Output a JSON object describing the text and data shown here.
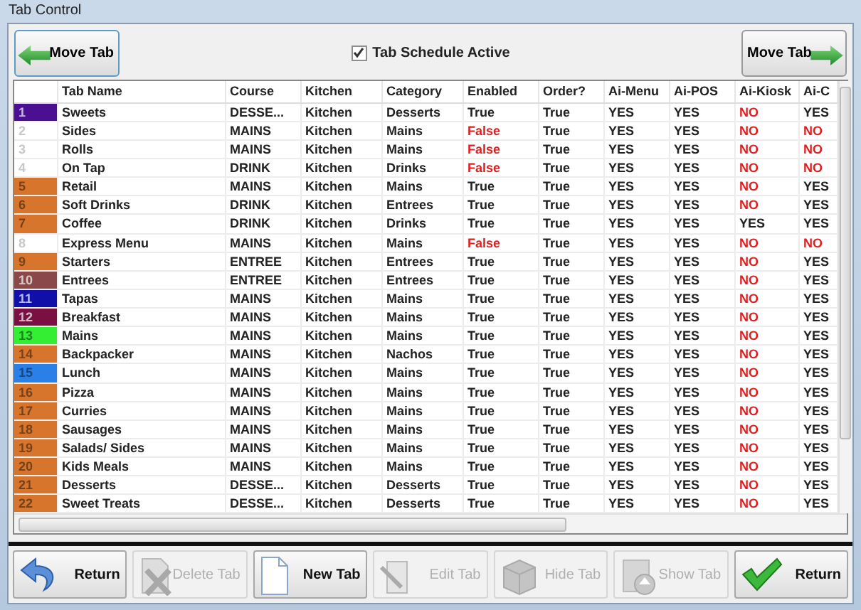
{
  "window": {
    "title": "Tab Control"
  },
  "toolbar": {
    "move_left": {
      "label": "Move Tab",
      "kind": "arrow-left"
    },
    "schedule": {
      "label": "Tab Schedule Active",
      "checked": true
    },
    "move_right": {
      "label": "Move Tab",
      "kind": "arrow-right"
    }
  },
  "table": {
    "columns": [
      "",
      "Tab Name",
      "Course",
      "Kitchen",
      "Category",
      "Enabled",
      "Order?",
      "Ai-Menu",
      "Ai-POS",
      "Ai-Kiosk",
      "Ai-C"
    ],
    "rows": [
      {
        "number": "1",
        "color": "#4b1091",
        "name": "Sweets",
        "course": "DESSE...",
        "kitchen": "Kitchen",
        "category": "Desserts",
        "enabled": {
          "text": "True",
          "on": true
        },
        "order": "True",
        "ai_menu": "YES",
        "ai_pos": "YES",
        "ai_kiosk": {
          "text": "NO",
          "on": false
        },
        "ai_c": {
          "text": "YES",
          "on": true
        }
      },
      {
        "number": "2",
        "name": "Sides",
        "course": "MAINS",
        "kitchen": "Kitchen",
        "category": "Mains",
        "enabled": {
          "text": "False",
          "on": false
        },
        "order": "True",
        "ai_menu": "YES",
        "ai_pos": "YES",
        "ai_kiosk": {
          "text": "NO",
          "on": false
        },
        "ai_c": {
          "text": "NO",
          "on": false
        }
      },
      {
        "number": "3",
        "name": "Rolls",
        "course": "MAINS",
        "kitchen": "Kitchen",
        "category": "Mains",
        "enabled": {
          "text": "False",
          "on": false
        },
        "order": "True",
        "ai_menu": "YES",
        "ai_pos": "YES",
        "ai_kiosk": {
          "text": "NO",
          "on": false
        },
        "ai_c": {
          "text": "NO",
          "on": false
        }
      },
      {
        "number": "4",
        "name": "On Tap",
        "course": "DRINK",
        "kitchen": "Kitchen",
        "category": "Drinks",
        "enabled": {
          "text": "False",
          "on": false
        },
        "order": "True",
        "ai_menu": "YES",
        "ai_pos": "YES",
        "ai_kiosk": {
          "text": "NO",
          "on": false
        },
        "ai_c": {
          "text": "NO",
          "on": false
        }
      },
      {
        "number": "5",
        "color": "#d8752c",
        "name": "Retail",
        "course": "MAINS",
        "kitchen": "Kitchen",
        "category": "Mains",
        "enabled": {
          "text": "True",
          "on": true
        },
        "order": "True",
        "ai_menu": "YES",
        "ai_pos": "YES",
        "ai_kiosk": {
          "text": "NO",
          "on": false
        },
        "ai_c": {
          "text": "YES",
          "on": true
        }
      },
      {
        "number": "6",
        "color": "#d8752c",
        "name": "Soft Drinks",
        "course": "DRINK",
        "kitchen": "Kitchen",
        "category": "Entrees",
        "enabled": {
          "text": "True",
          "on": true
        },
        "order": "True",
        "ai_menu": "YES",
        "ai_pos": "YES",
        "ai_kiosk": {
          "text": "NO",
          "on": false
        },
        "ai_c": {
          "text": "YES",
          "on": true
        }
      },
      {
        "number": "7",
        "color": "#d8752c",
        "name": "Coffee",
        "course": "DRINK",
        "kitchen": "Kitchen",
        "category": "Drinks",
        "enabled": {
          "text": "True",
          "on": true
        },
        "order": "True",
        "ai_menu": "YES",
        "ai_pos": "YES",
        "ai_kiosk": {
          "text": "YES",
          "on": true
        },
        "ai_c": {
          "text": "YES",
          "on": true
        }
      },
      {
        "number": "8",
        "name": "Express Menu",
        "course": "MAINS",
        "kitchen": "Kitchen",
        "category": "Mains",
        "enabled": {
          "text": "False",
          "on": false
        },
        "order": "True",
        "ai_menu": "YES",
        "ai_pos": "YES",
        "ai_kiosk": {
          "text": "NO",
          "on": false
        },
        "ai_c": {
          "text": "NO",
          "on": false
        }
      },
      {
        "number": "9",
        "color": "#d8752c",
        "name": "Starters",
        "course": "ENTREE",
        "kitchen": "Kitchen",
        "category": "Entrees",
        "enabled": {
          "text": "True",
          "on": true
        },
        "order": "True",
        "ai_menu": "YES",
        "ai_pos": "YES",
        "ai_kiosk": {
          "text": "NO",
          "on": false
        },
        "ai_c": {
          "text": "YES",
          "on": true
        }
      },
      {
        "number": "10",
        "color": "#8a4848",
        "name": "Entrees",
        "course": "ENTREE",
        "kitchen": "Kitchen",
        "category": "Entrees",
        "enabled": {
          "text": "True",
          "on": true
        },
        "order": "True",
        "ai_menu": "YES",
        "ai_pos": "YES",
        "ai_kiosk": {
          "text": "NO",
          "on": false
        },
        "ai_c": {
          "text": "YES",
          "on": true
        }
      },
      {
        "number": "11",
        "color": "#1010a8",
        "name": "Tapas",
        "course": "MAINS",
        "kitchen": "Kitchen",
        "category": "Mains",
        "enabled": {
          "text": "True",
          "on": true
        },
        "order": "True",
        "ai_menu": "YES",
        "ai_pos": "YES",
        "ai_kiosk": {
          "text": "NO",
          "on": false
        },
        "ai_c": {
          "text": "YES",
          "on": true
        }
      },
      {
        "number": "12",
        "color": "#7a1042",
        "name": "Breakfast",
        "course": "MAINS",
        "kitchen": "Kitchen",
        "category": "Mains",
        "enabled": {
          "text": "True",
          "on": true
        },
        "order": "True",
        "ai_menu": "YES",
        "ai_pos": "YES",
        "ai_kiosk": {
          "text": "NO",
          "on": false
        },
        "ai_c": {
          "text": "YES",
          "on": true
        }
      },
      {
        "number": "13",
        "color": "#33ee33",
        "name": "Mains",
        "course": "MAINS",
        "kitchen": "Kitchen",
        "category": "Mains",
        "enabled": {
          "text": "True",
          "on": true
        },
        "order": "True",
        "ai_menu": "YES",
        "ai_pos": "YES",
        "ai_kiosk": {
          "text": "NO",
          "on": false
        },
        "ai_c": {
          "text": "YES",
          "on": true
        }
      },
      {
        "number": "14",
        "color": "#d8752c",
        "name": "Backpacker",
        "course": "MAINS",
        "kitchen": "Kitchen",
        "category": "Nachos",
        "enabled": {
          "text": "True",
          "on": true
        },
        "order": "True",
        "ai_menu": "YES",
        "ai_pos": "YES",
        "ai_kiosk": {
          "text": "NO",
          "on": false
        },
        "ai_c": {
          "text": "YES",
          "on": true
        }
      },
      {
        "number": "15",
        "color": "#2a80e6",
        "name": "Lunch",
        "course": "MAINS",
        "kitchen": "Kitchen",
        "category": "Mains",
        "enabled": {
          "text": "True",
          "on": true
        },
        "order": "True",
        "ai_menu": "YES",
        "ai_pos": "YES",
        "ai_kiosk": {
          "text": "NO",
          "on": false
        },
        "ai_c": {
          "text": "YES",
          "on": true
        }
      },
      {
        "number": "16",
        "color": "#d8752c",
        "name": "Pizza",
        "course": "MAINS",
        "kitchen": "Kitchen",
        "category": "Mains",
        "enabled": {
          "text": "True",
          "on": true
        },
        "order": "True",
        "ai_menu": "YES",
        "ai_pos": "YES",
        "ai_kiosk": {
          "text": "NO",
          "on": false
        },
        "ai_c": {
          "text": "YES",
          "on": true
        }
      },
      {
        "number": "17",
        "color": "#d8752c",
        "name": "Curries",
        "course": "MAINS",
        "kitchen": "Kitchen",
        "category": "Mains",
        "enabled": {
          "text": "True",
          "on": true
        },
        "order": "True",
        "ai_menu": "YES",
        "ai_pos": "YES",
        "ai_kiosk": {
          "text": "NO",
          "on": false
        },
        "ai_c": {
          "text": "YES",
          "on": true
        }
      },
      {
        "number": "18",
        "color": "#d8752c",
        "name": "Sausages",
        "course": "MAINS",
        "kitchen": "Kitchen",
        "category": "Mains",
        "enabled": {
          "text": "True",
          "on": true
        },
        "order": "True",
        "ai_menu": "YES",
        "ai_pos": "YES",
        "ai_kiosk": {
          "text": "NO",
          "on": false
        },
        "ai_c": {
          "text": "YES",
          "on": true
        }
      },
      {
        "number": "19",
        "color": "#d8752c",
        "name": "Salads/ Sides",
        "course": "MAINS",
        "kitchen": "Kitchen",
        "category": "Mains",
        "enabled": {
          "text": "True",
          "on": true
        },
        "order": "True",
        "ai_menu": "YES",
        "ai_pos": "YES",
        "ai_kiosk": {
          "text": "NO",
          "on": false
        },
        "ai_c": {
          "text": "YES",
          "on": true
        }
      },
      {
        "number": "20",
        "color": "#d8752c",
        "name": "Kids Meals",
        "course": "MAINS",
        "kitchen": "Kitchen",
        "category": "Mains",
        "enabled": {
          "text": "True",
          "on": true
        },
        "order": "True",
        "ai_menu": "YES",
        "ai_pos": "YES",
        "ai_kiosk": {
          "text": "NO",
          "on": false
        },
        "ai_c": {
          "text": "YES",
          "on": true
        }
      },
      {
        "number": "21",
        "color": "#d8752c",
        "name": "Desserts",
        "course": "DESSE...",
        "kitchen": "Kitchen",
        "category": "Desserts",
        "enabled": {
          "text": "True",
          "on": true
        },
        "order": "True",
        "ai_menu": "YES",
        "ai_pos": "YES",
        "ai_kiosk": {
          "text": "NO",
          "on": false
        },
        "ai_c": {
          "text": "YES",
          "on": true
        }
      },
      {
        "number": "22",
        "color": "#d8752c",
        "name": "Sweet Treats",
        "course": "DESSE...",
        "kitchen": "Kitchen",
        "category": "Desserts",
        "enabled": {
          "text": "True",
          "on": true
        },
        "order": "True",
        "ai_menu": "YES",
        "ai_pos": "YES",
        "ai_kiosk": {
          "text": "NO",
          "on": false
        },
        "ai_c": {
          "text": "YES",
          "on": true
        }
      }
    ]
  },
  "buttons": [
    {
      "label": "Return",
      "kind": "return",
      "disabled": false
    },
    {
      "label": "Delete Tab",
      "kind": "delete",
      "disabled": true
    },
    {
      "label": "New Tab",
      "kind": "new",
      "disabled": false
    },
    {
      "label": "Edit Tab",
      "kind": "edit",
      "disabled": true
    },
    {
      "label": "Hide Tab",
      "kind": "hide",
      "disabled": true
    },
    {
      "label": "Show Tab",
      "kind": "show",
      "disabled": true
    },
    {
      "label": "Return",
      "kind": "ok",
      "disabled": false
    }
  ]
}
